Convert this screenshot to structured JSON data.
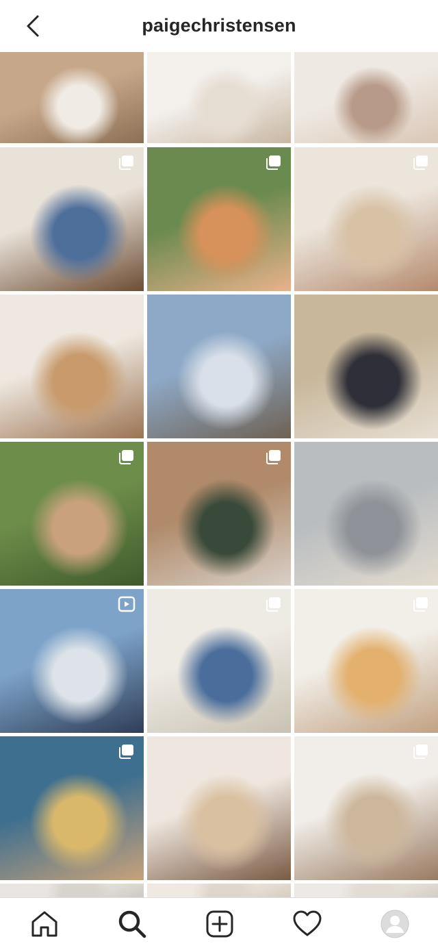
{
  "header": {
    "title": "paigechristensen",
    "back_icon": "chevron-left-icon"
  },
  "grid": {
    "badges": {
      "multi": "multiple-photos-icon",
      "reel": "reel-icon"
    },
    "tiles": [
      {
        "id": "post-1",
        "colors": [
          "#c7a78a",
          "#f0ebe4",
          "#8c6f55"
        ],
        "badge": ""
      },
      {
        "id": "post-2",
        "colors": [
          "#f3f0ec",
          "#e6ddd2",
          "#c9b7a3"
        ],
        "badge": ""
      },
      {
        "id": "post-3",
        "colors": [
          "#efe9e3",
          "#b79a88",
          "#d9c7b6"
        ],
        "badge": ""
      },
      {
        "id": "post-4",
        "colors": [
          "#e9e2d9",
          "#4f6f9b",
          "#6d4d35"
        ],
        "badge": "multi"
      },
      {
        "id": "post-5",
        "colors": [
          "#6b8a4f",
          "#d7915a",
          "#e9b28c"
        ],
        "badge": "multi"
      },
      {
        "id": "post-6",
        "colors": [
          "#ece5dc",
          "#d8c2a6",
          "#b58a6e"
        ],
        "badge": "multi"
      },
      {
        "id": "post-7",
        "colors": [
          "#eee8e0",
          "#c89a6c",
          "#9c7352"
        ],
        "badge": ""
      },
      {
        "id": "post-8",
        "colors": [
          "#8ea9c7",
          "#d8dfe8",
          "#6e6153"
        ],
        "badge": ""
      },
      {
        "id": "post-9",
        "colors": [
          "#c8b79b",
          "#2e2f38",
          "#e7dfd3"
        ],
        "badge": ""
      },
      {
        "id": "post-10",
        "colors": [
          "#6d8d4a",
          "#c9a27d",
          "#3f5a2c"
        ],
        "badge": "multi"
      },
      {
        "id": "post-11",
        "colors": [
          "#b08a6a",
          "#3a4a3a",
          "#d8d0c8"
        ],
        "badge": "multi"
      },
      {
        "id": "post-12",
        "colors": [
          "#b9bdc0",
          "#8f9399",
          "#e3dbcf"
        ],
        "badge": ""
      },
      {
        "id": "post-13",
        "colors": [
          "#7da3c9",
          "#dde3e8",
          "#2f3d57"
        ],
        "badge": "reel"
      },
      {
        "id": "post-14",
        "colors": [
          "#eeeae4",
          "#4a6d9b",
          "#c9c2b3"
        ],
        "badge": "multi"
      },
      {
        "id": "post-15",
        "colors": [
          "#f2efe9",
          "#e3b06e",
          "#c2a182"
        ],
        "badge": "multi"
      },
      {
        "id": "post-16",
        "colors": [
          "#3f6f8f",
          "#d9b86c",
          "#c9a27a"
        ],
        "badge": "multi"
      },
      {
        "id": "post-17",
        "colors": [
          "#efe7df",
          "#d9c0a0",
          "#7a5a44"
        ],
        "badge": ""
      },
      {
        "id": "post-18",
        "colors": [
          "#f1ede8",
          "#cdb79c",
          "#9a7b62"
        ],
        "badge": "multi"
      },
      {
        "id": "post-19",
        "colors": [
          "#e9e6e2",
          "#d8d3cc",
          "#c9c3bb"
        ],
        "badge": ""
      },
      {
        "id": "post-20",
        "colors": [
          "#efe9e2",
          "#e0d7cc",
          "#d2c6b8"
        ],
        "badge": ""
      },
      {
        "id": "post-21",
        "colors": [
          "#ede9e4",
          "#e2dcd5",
          "#cfc7bd"
        ],
        "badge": ""
      }
    ]
  },
  "tabbar": {
    "tabs": [
      {
        "name": "tab-home",
        "icon": "home-icon"
      },
      {
        "name": "tab-search",
        "icon": "search-icon"
      },
      {
        "name": "tab-create",
        "icon": "add-post-icon"
      },
      {
        "name": "tab-activity",
        "icon": "heart-icon"
      },
      {
        "name": "tab-profile",
        "icon": "avatar-icon"
      }
    ],
    "active": "tab-search"
  },
  "colors": {
    "text": "#262626",
    "divider": "#dbdbdb",
    "icon": "#262626"
  }
}
